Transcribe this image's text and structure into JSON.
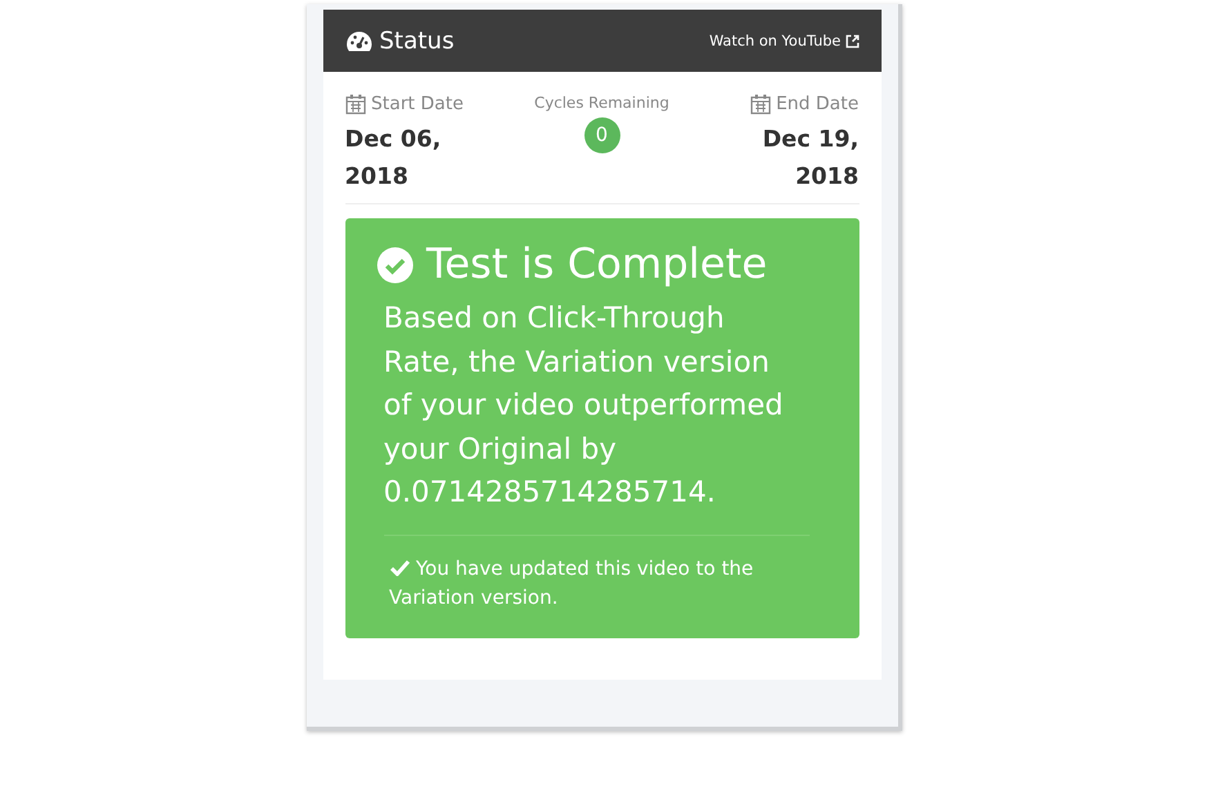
{
  "panel": {
    "title": "Status",
    "link": "Watch on YouTube"
  },
  "start": {
    "label": "Start Date",
    "value": "Dec 06, 2018"
  },
  "cycles": {
    "label": "Cycles Remaining",
    "count": "0"
  },
  "end": {
    "label": "End Date",
    "value": "Dec 19, 2018"
  },
  "result": {
    "title": "Test is Complete",
    "message": "Based on Click-Through Rate, the Variation version of your video outperformed your Original by 0.0714285714285714.",
    "note": "You have updated this video to the Variation version."
  }
}
